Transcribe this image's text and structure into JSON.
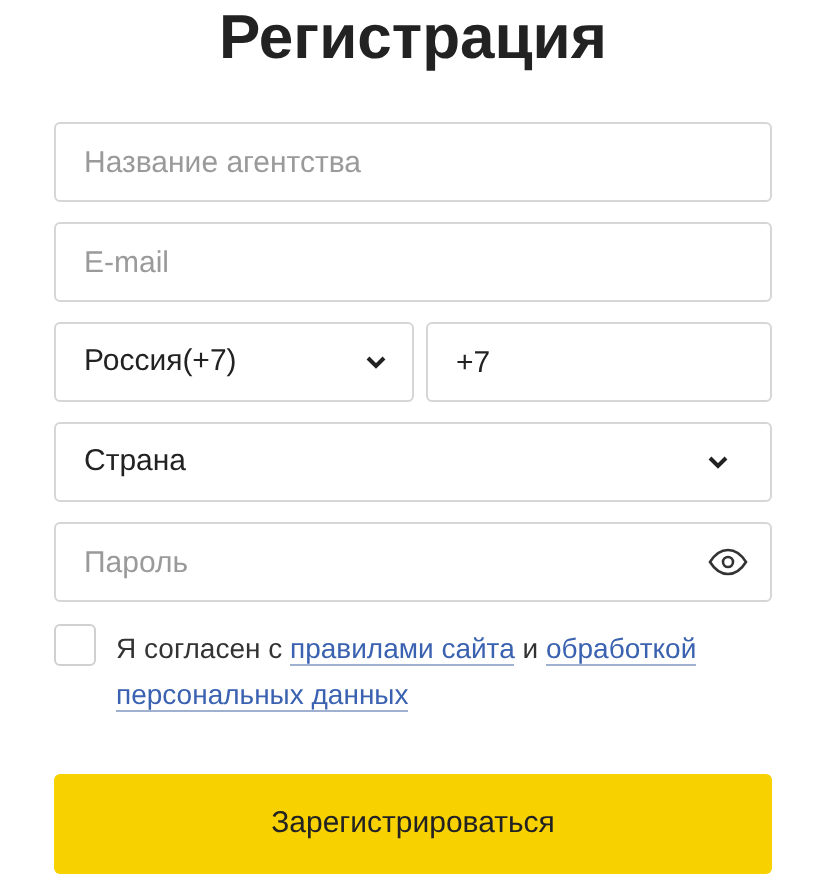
{
  "title": "Регистрация",
  "fields": [
    {
      "kind": "text",
      "placeholder": "Название агентства"
    },
    {
      "kind": "text",
      "placeholder": "E-mail"
    },
    {
      "kind": "phone",
      "code_select": "Россия(+7)",
      "value": "+7"
    },
    {
      "kind": "select",
      "value": "Страна"
    },
    {
      "kind": "password",
      "placeholder": "Пароль"
    }
  ],
  "consent": {
    "checked": false,
    "parts": [
      {
        "kind": "text",
        "text": "Я согласен с"
      },
      {
        "kind": "link",
        "text": "правилами сайта"
      },
      {
        "kind": "text",
        "text": "и"
      },
      {
        "kind": "link",
        "text": "обработкой"
      },
      {
        "kind": "link",
        "text": "персональных данных"
      }
    ]
  },
  "submit": "Зарегистрироваться"
}
